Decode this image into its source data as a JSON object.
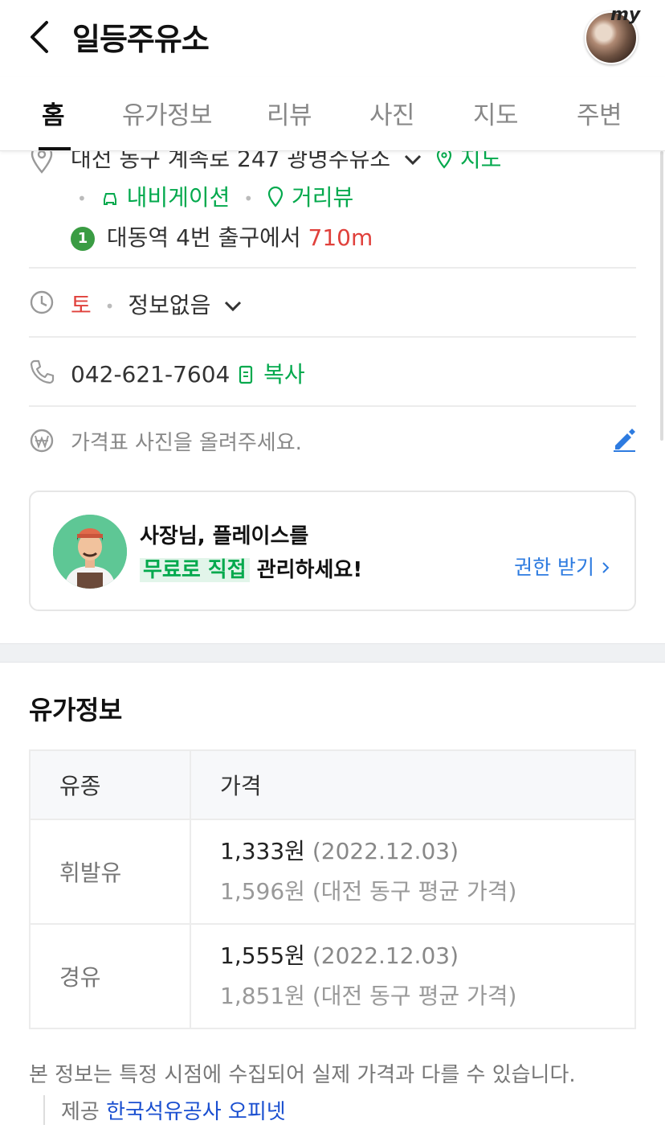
{
  "header": {
    "title": "일등주유소",
    "avatar_badge": "my"
  },
  "tabs": [
    {
      "label": "홈",
      "active": true
    },
    {
      "label": "유가정보"
    },
    {
      "label": "리뷰"
    },
    {
      "label": "사진"
    },
    {
      "label": "지도"
    },
    {
      "label": "주변"
    }
  ],
  "place": {
    "address": "대전 동구 계족로 247 광명주유소",
    "map_link": "지도",
    "navigation_link": "내비게이션",
    "street_view_link": "거리뷰",
    "subway_line": "1",
    "subway_station": "대동역",
    "subway_exit": "4번 출구에서",
    "subway_distance": "710m",
    "hours_day": "토",
    "hours_status": "정보없음",
    "phone": "042-621-7604",
    "copy_label": "복사",
    "price_photo_prompt": "가격표 사진을 올려주세요."
  },
  "owner_card": {
    "line1": "사장님, 플레이스를",
    "highlight": "무료로 직접",
    "line2_rest": "관리하세요!",
    "cta": "권한 받기"
  },
  "fuel": {
    "section_title": "유가정보",
    "columns": [
      "유종",
      "가격"
    ],
    "rows": [
      {
        "type": "휘발유",
        "price": "1,333원",
        "date": "(2022.12.03)",
        "avg": "1,596원 (대전 동구 평균 가격)"
      },
      {
        "type": "경유",
        "price": "1,555원",
        "date": "(2022.12.03)",
        "avg": "1,851원 (대전 동구 평균 가격)"
      }
    ],
    "notice": "본 정보는 특정 시점에 수집되어 실제 가격과 다를 수 있습니다.",
    "source_label": "제공",
    "source_link": "한국석유공사 오피넷"
  },
  "colors": {
    "accent_green": "#03a94d",
    "link_blue": "#2d7be0",
    "distance_red": "#e0413c"
  }
}
